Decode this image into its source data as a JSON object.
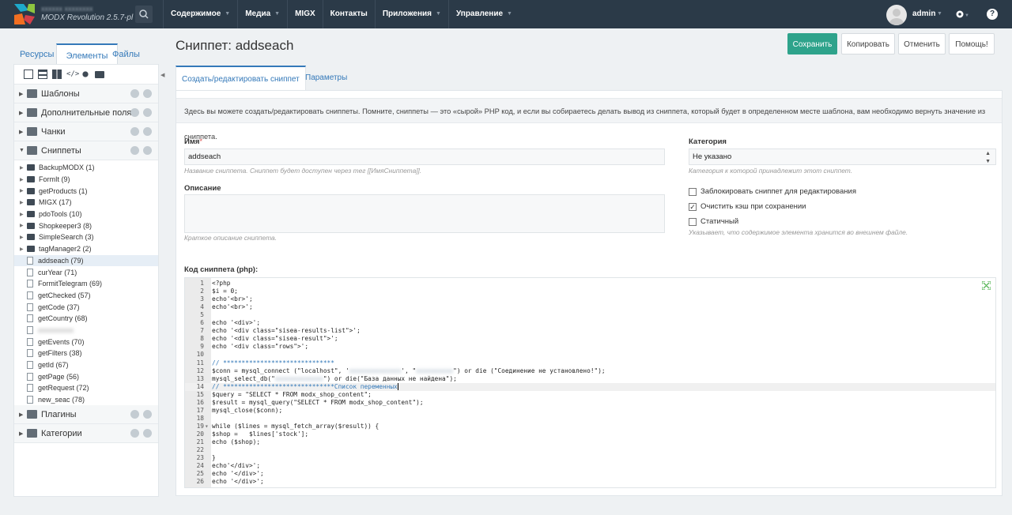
{
  "header": {
    "brand_blurred": "xxxxxx xxxxxxxx",
    "brand_version": "MODX Revolution 2.5.7-pl",
    "nav": [
      {
        "label": "Содержимое",
        "caret": true
      },
      {
        "label": "Медиа",
        "caret": true
      },
      {
        "label": "MIGX",
        "caret": false
      },
      {
        "label": "Контакты",
        "caret": false
      },
      {
        "label": "Приложения",
        "caret": true
      },
      {
        "label": "Управление",
        "caret": true
      }
    ],
    "user": "admin",
    "help": "?"
  },
  "sidebar": {
    "tabs": [
      "Ресурсы",
      "Элементы",
      "Файлы"
    ],
    "categories_top": [
      {
        "label": "Шаблоны",
        "icon": "template-icon"
      },
      {
        "label": "Дополнительные поля",
        "icon": "tv-icon"
      },
      {
        "label": "Чанки",
        "icon": "chunk-icon"
      },
      {
        "label": "Сниппеты",
        "icon": "code-icon"
      }
    ],
    "snippet_folders": [
      "BackupMODX (1)",
      "FormIt (9)",
      "getProducts (1)",
      "MIGX (17)",
      "pdoTools (10)",
      "Shopkeeper3 (8)",
      "SimpleSearch (3)",
      "tagManager2 (2)"
    ],
    "snippet_files": [
      "addseach (79)",
      "curYear (71)",
      "FormitTelegram (69)",
      "getChecked (57)",
      "getCode (37)",
      "getCountry (68)",
      "xxxxxxxxxx",
      "getEvents (70)",
      "getFilters (38)",
      "getId (67)",
      "getPage (56)",
      "getRequest (72)",
      "new_seac (78)"
    ],
    "categories_bottom": [
      {
        "label": "Плагины",
        "icon": "plugin-icon"
      },
      {
        "label": "Категории",
        "icon": "category-icon"
      }
    ]
  },
  "page": {
    "title": "Сниппет: addseach",
    "buttons": {
      "save": "Сохранить",
      "copy": "Копировать",
      "cancel": "Отменить",
      "help": "Помощь!"
    },
    "tabs": [
      "Создать/редактировать сниппет",
      "Параметры"
    ],
    "description": "Здесь вы можете создать/редактировать сниппеты. Помните, сниппеты — это «сырой» PHP код, и если вы собираетесь делать вывод из сниппета, который будет в определенном месте шаблона, вам необходимо вернуть значение из сниппета.",
    "name_label": "Имя",
    "name_required": "*",
    "name_value": "addseach",
    "name_hint": "Название сниппета. Сниппет будет доступен через тег [[ИмяСниппета]].",
    "description_label": "Описание",
    "description_hint": "Краткое описание сниппета.",
    "category_label": "Категория",
    "category_value": "Не указано",
    "category_hint": "Категория к которой принадлежит этот сниппет.",
    "lock_label": "Заблокировать сниппет для редактирования",
    "lock_checked": false,
    "clear_cache_label": "Очистить кэш при сохранении",
    "clear_cache_checked": true,
    "static_label": "Статичный",
    "static_checked": false,
    "static_hint": "Указывает, что содержимое элемента хранится во внешнем файле.",
    "code_label": "Код сниппета (php):"
  },
  "code_lines": [
    "<?php",
    "$i = 0;",
    "echo'<br>';",
    "echo'<br>';",
    "",
    "echo '<div>';",
    "echo '<div class=\"sisea-results-list\">';",
    "echo '<div class=\"sisea-result\">';",
    "echo '<div class=\"rows\">';",
    "",
    "// ******************************",
    "$conn = mysql_connect (\"localhost\", '[BLUR1]', \"[BLUR2]\") or die (\"Соединение не установлено!\");",
    "mysql_select_db(\"[BLUR3]\") or die(\"База данных не найдена\");",
    "// ******************************Список переменных",
    "$query = \"SELECT * FROM modx_shop_content\";",
    "$result = mysql_query(\"SELECT * FROM modx_shop_content\");",
    "mysql_close($conn);",
    "",
    "while ($lines = mysql_fetch_array($result)) {",
    "$shop =   $lines['stock'];",
    "echo ($shop);",
    "",
    "}",
    "echo'</div>';",
    "echo '</div>';",
    "echo '</div>';"
  ],
  "code_blurred": [
    "xxxxxxxxxxxxxx",
    "xxxxxxxxxx",
    "xxxxxxxxxxxxx"
  ],
  "colors": {
    "accent": "#3479b9",
    "topbar": "#2b3a48",
    "save": "#2ea38b"
  }
}
